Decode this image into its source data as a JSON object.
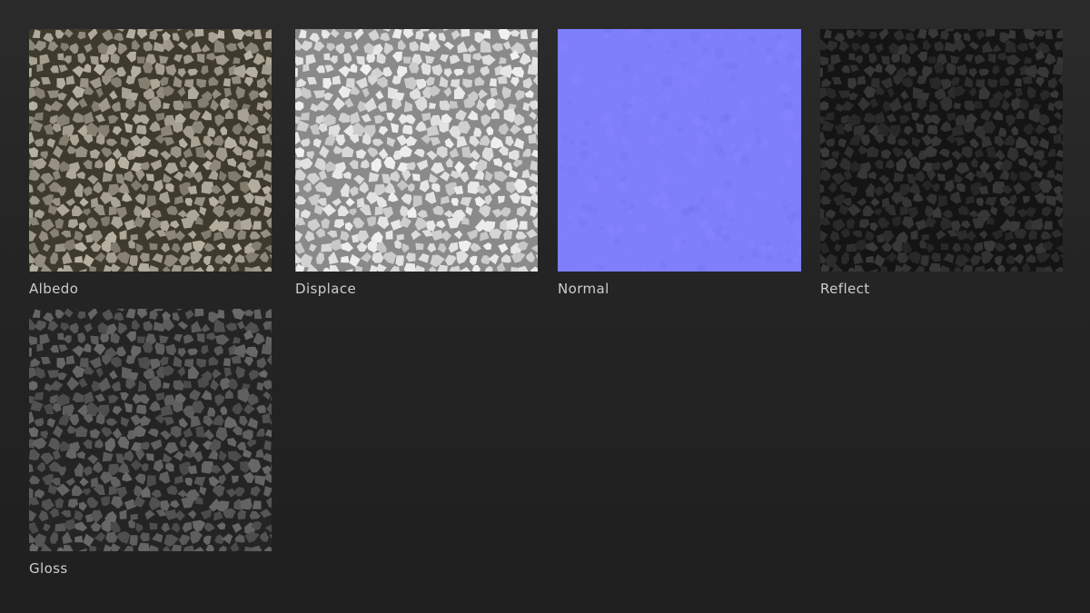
{
  "maps": [
    {
      "label": "Albedo",
      "grout": "#3f3a2e",
      "stone_light": "#b9b3a4",
      "stone_dark": "#7f7a6c",
      "icon": "pebble-texture"
    },
    {
      "label": "Displace",
      "grout": "#8a8a8a",
      "stone_light": "#f0f0f0",
      "stone_dark": "#c6c6c6",
      "icon": "pebble-texture"
    },
    {
      "label": "Normal",
      "base": "#7f7ffb",
      "icon": "normal-map-texture"
    },
    {
      "label": "Reflect",
      "grout": "#141414",
      "stone_light": "#3a3a3a",
      "stone_dark": "#262626",
      "icon": "pebble-texture"
    },
    {
      "label": "Gloss",
      "grout": "#242424",
      "stone_light": "#6a6a6a",
      "stone_dark": "#4a4a4a",
      "icon": "pebble-texture"
    }
  ]
}
